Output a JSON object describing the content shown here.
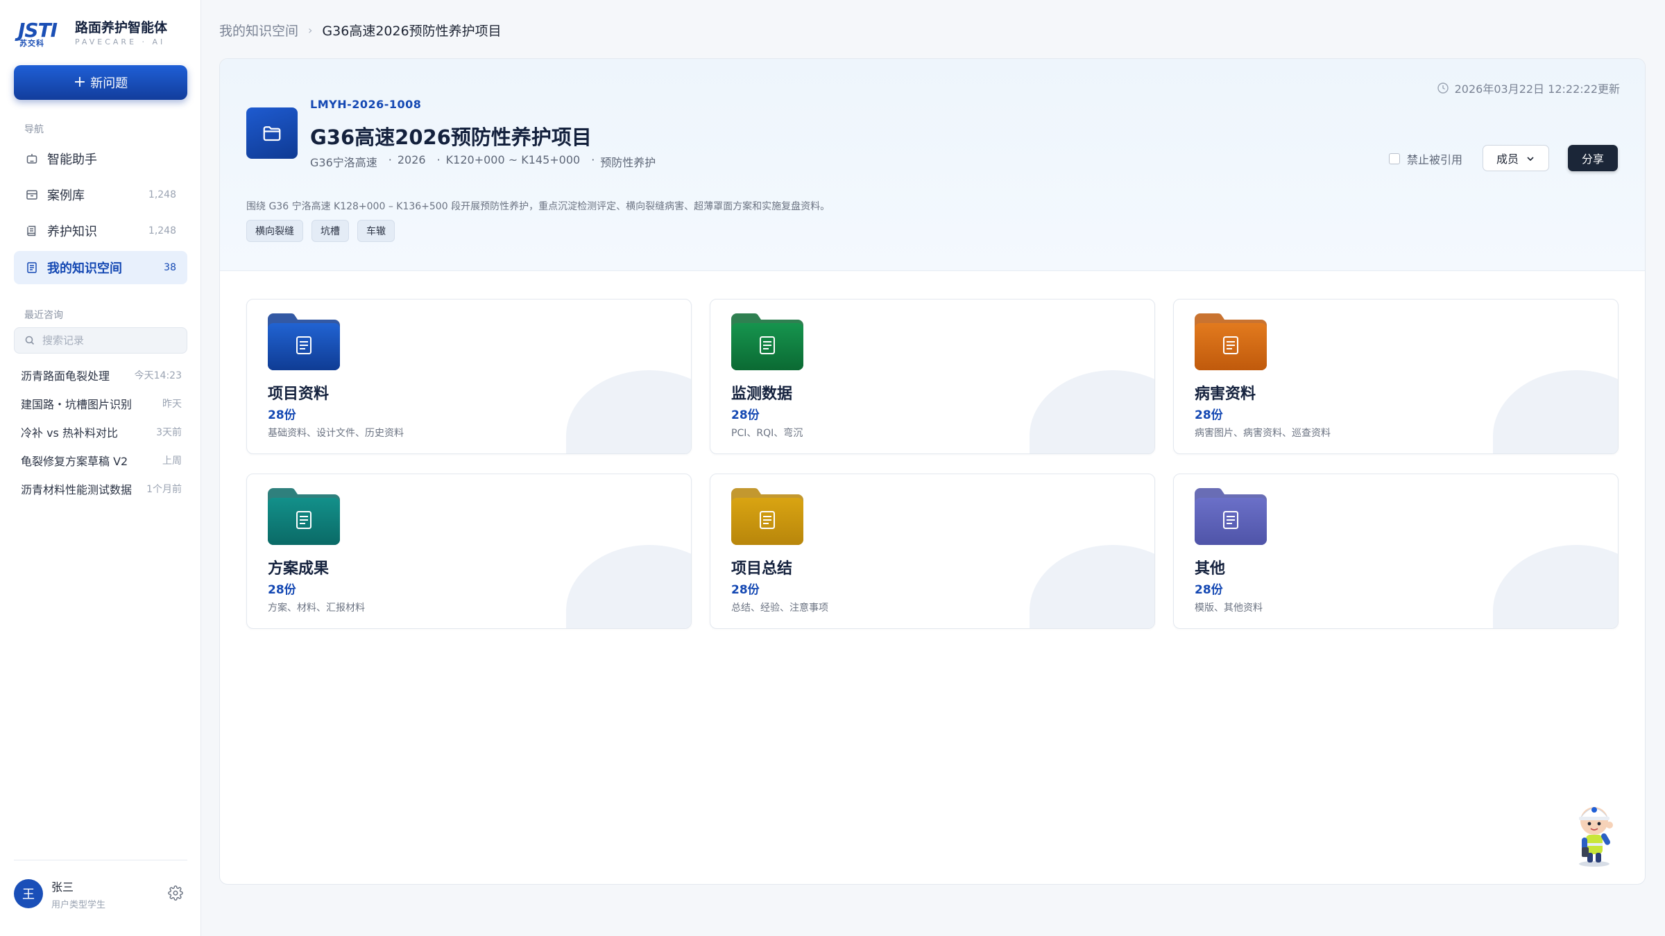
{
  "brand": {
    "mark": "JSTI",
    "mark_sub": "苏交科",
    "title": "路面养护智能体",
    "subtitle": "PAVECARE · AI"
  },
  "sidebar": {
    "new_label": "新问题",
    "nav_label": "导航",
    "items": [
      {
        "label": "智能助手",
        "count": "",
        "icon": "robot-icon"
      },
      {
        "label": "案例库",
        "count": "1,248",
        "icon": "archive-box-icon"
      },
      {
        "label": "养护知识",
        "count": "1,248",
        "icon": "book-icon"
      },
      {
        "label": "我的知识空间",
        "count": "38",
        "icon": "document-icon",
        "active": true
      }
    ],
    "recent_label": "最近咨询",
    "search_placeholder": "搜索记录",
    "recent": [
      {
        "title": "沥青路面龟裂处理",
        "time": "今天14:23"
      },
      {
        "title": "建国路・坑槽图片识别",
        "time": "昨天"
      },
      {
        "title": "冷补 vs 热补料对比",
        "time": "3天前"
      },
      {
        "title": "龟裂修复方案草稿 V2",
        "time": "上周"
      },
      {
        "title": "沥青材料性能测试数据",
        "time": "1个月前"
      }
    ]
  },
  "user": {
    "avatar_initial": "王",
    "name": "张三",
    "role": "用户类型学生"
  },
  "breadcrumb": {
    "parent": "我的知识空间",
    "separator": "›",
    "current": "G36高速2026预防性养护项目"
  },
  "project": {
    "code": "LMYH-2026-1008",
    "title": "G36高速2026预防性养护项目",
    "meta": [
      "G36宁洛高速",
      "2026",
      "K120+000 ~ K145+000",
      "预防性养护"
    ],
    "meta_separator": "·",
    "updated": "2026年03月22日 12:22:22更新",
    "ban_ref_label": "禁止被引用",
    "members_label": "成员",
    "share_label": "分享",
    "description": "围绕 G36 宁洛高速 K128+000 – K136+500 段开展预防性养护，重点沉淀检测评定、横向裂缝病害、超薄罩面方案和实施复盘资料。",
    "tags": [
      "横向裂缝",
      "坑槽",
      "车辙"
    ]
  },
  "folders": [
    {
      "title": "项目资料",
      "count": "28份",
      "desc": "基础资料、设计文件、历史资料",
      "color_top": "#2163d2",
      "color_bottom": "#0f3c94"
    },
    {
      "title": "监测数据",
      "count": "28份",
      "desc": "PCI、RQI、弯沉",
      "color_top": "#16944e",
      "color_bottom": "#0b6a33"
    },
    {
      "title": "病害资料",
      "count": "28份",
      "desc": "病害图片、病害资料、巡查资料",
      "color_top": "#e27a1e",
      "color_bottom": "#c05a0c"
    },
    {
      "title": "方案成果",
      "count": "28份",
      "desc": "方案、材料、汇报材料",
      "color_top": "#13908a",
      "color_bottom": "#0a6a66"
    },
    {
      "title": "项目总结",
      "count": "28份",
      "desc": "总结、经验、注意事项",
      "color_top": "#d9a412",
      "color_bottom": "#b8860b"
    },
    {
      "title": "其他",
      "count": "28份",
      "desc": "模版、其他资料",
      "color_top": "#6b70c8",
      "color_bottom": "#4f54a8"
    }
  ]
}
